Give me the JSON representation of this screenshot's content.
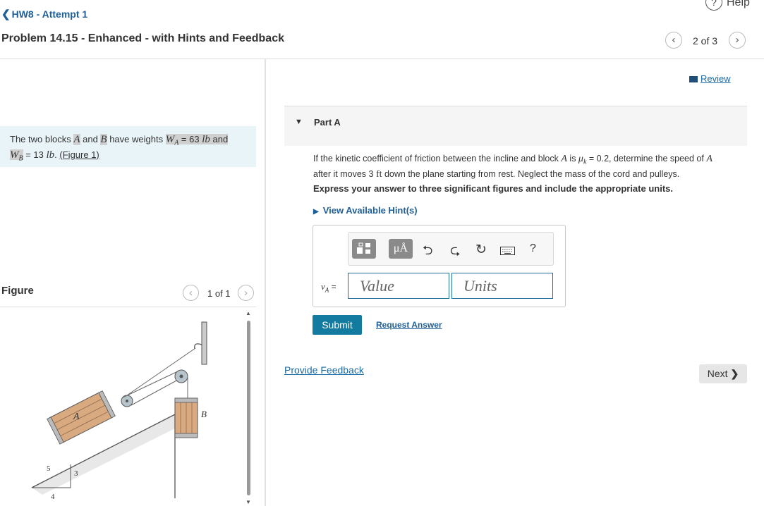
{
  "header": {
    "back_label": "HW8 - Attempt 1",
    "help_label": "Help",
    "problem_title": "Problem 14.15 - Enhanced - with Hints and Feedback",
    "nav_count": "2 of 3"
  },
  "statement": {
    "p1": "The two blocks ",
    "A": "A",
    "p2": " and ",
    "B": "B",
    "p3": " have weights ",
    "WA": "W",
    "WA_sub": "A",
    "p4": " = 63 ",
    "lb1": "lb",
    "p5": " and",
    "WB": "W",
    "WB_sub": "B",
    "p6": " = 13 ",
    "lb2": "lb",
    "p7": ". ",
    "figure_link": "(Figure 1)"
  },
  "figure": {
    "label": "Figure",
    "count": "1 of 1",
    "labels": {
      "A": "A",
      "B": "B",
      "five": "5",
      "three": "3",
      "four": "4"
    }
  },
  "review_label": "Review",
  "part": {
    "title": "Part A",
    "q1": "If the kinetic coefficient of friction between the incline and block ",
    "qA": "A",
    "q2": " is ",
    "mu": "μ",
    "mu_sub": "k",
    "q3": " = 0.2, determine the speed of ",
    "qA2": "A",
    "q4": "after it moves 3 ",
    "ft": "ft",
    "q5": " down the plane starting from rest. Neglect the mass of the cord and pulleys.",
    "express": "Express your answer to three significant figures and include the appropriate units.",
    "hints": "View Available Hint(s)"
  },
  "answer": {
    "var": "v",
    "var_sub": "A",
    "eq": " =",
    "value_placeholder": "Value",
    "units_placeholder": "Units",
    "toolbar": {
      "templates": "▮▯",
      "units": "μÅ",
      "help": "?"
    }
  },
  "buttons": {
    "submit": "Submit",
    "request": "Request Answer",
    "feedback": "Provide Feedback",
    "next": "Next"
  }
}
